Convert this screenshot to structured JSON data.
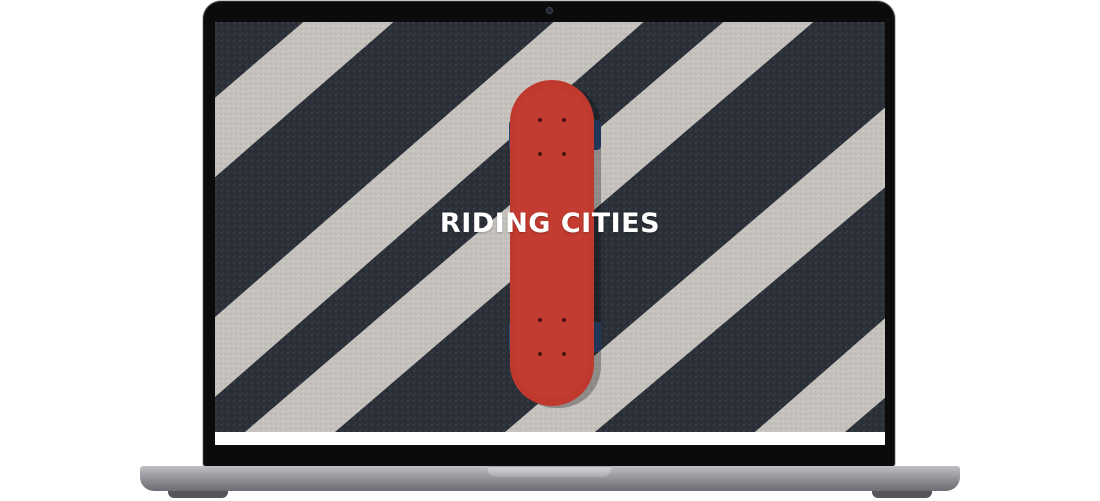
{
  "hero": {
    "title": "RIDING CITIES",
    "image": "skateboard-on-crosswalk"
  },
  "colors": {
    "asphalt": "#2a2f36",
    "stripe": "#c9c7c4",
    "deck": "#c0392f",
    "wheels": "#2e4a78",
    "bezel": "#0b0b0c",
    "chassis": "#a8a9ad"
  }
}
